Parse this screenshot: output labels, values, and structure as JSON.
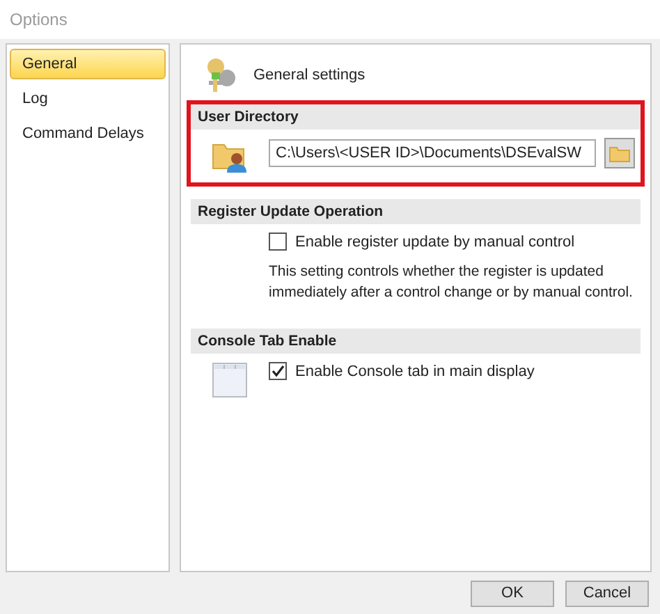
{
  "window": {
    "title": "Options"
  },
  "sidebar": {
    "items": [
      {
        "label": "General",
        "selected": true
      },
      {
        "label": "Log",
        "selected": false
      },
      {
        "label": "Command Delays",
        "selected": false
      }
    ]
  },
  "page": {
    "title": "General settings"
  },
  "sections": [
    {
      "kind": "directory",
      "title": "User Directory",
      "highlighted": true,
      "value": "C:\\Users\\<USER ID>\\Documents\\DSEvalSW"
    },
    {
      "kind": "checkbox",
      "title": "Register Update Operation",
      "highlighted": false,
      "label": "Enable register update by manual control",
      "checked": false,
      "description": "This setting controls whether the register is updated immediately after a control change or by manual control."
    },
    {
      "kind": "console",
      "title": "Console Tab Enable",
      "highlighted": false,
      "label": "Enable Console tab in main display",
      "checked": true
    }
  ],
  "buttons": [
    "OK",
    "Cancel"
  ]
}
